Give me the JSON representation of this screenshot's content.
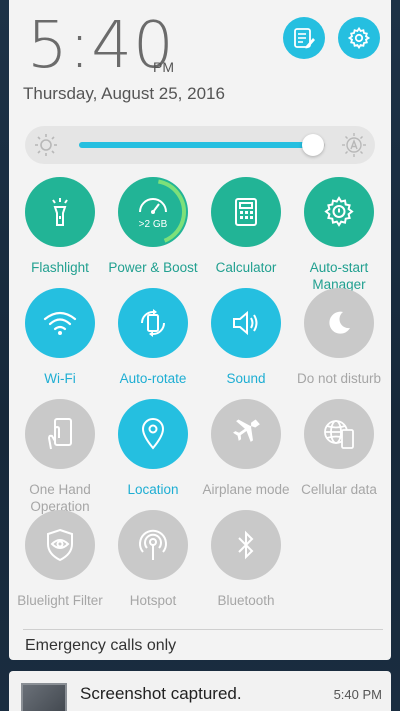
{
  "status": {
    "time": "5:40",
    "ampm": "PM",
    "date": "Thursday, August 25, 2016"
  },
  "brightness": {
    "level": 0.95
  },
  "tiles": [
    {
      "label": "Flashlight",
      "icon": "flashlight-icon",
      "state": "on-green"
    },
    {
      "label": "Power & Boost",
      "icon": "boost-gauge-icon",
      "state": "on-green",
      "badge": ">2 GB"
    },
    {
      "label": "Calculator",
      "icon": "calculator-icon",
      "state": "on-green"
    },
    {
      "label": "Auto-start Manager",
      "icon": "gear-icon",
      "state": "on-green"
    },
    {
      "label": "Wi-Fi",
      "icon": "wifi-icon",
      "state": "on-blue"
    },
    {
      "label": "Auto-rotate",
      "icon": "rotate-icon",
      "state": "on-blue"
    },
    {
      "label": "Sound",
      "icon": "speaker-icon",
      "state": "on-blue"
    },
    {
      "label": "Do not disturb",
      "icon": "moon-icon",
      "state": "off"
    },
    {
      "label": "One Hand Operation",
      "icon": "one-hand-icon",
      "state": "off"
    },
    {
      "label": "Location",
      "icon": "location-pin-icon",
      "state": "on-blue"
    },
    {
      "label": "Airplane mode",
      "icon": "airplane-icon",
      "state": "off"
    },
    {
      "label": "Cellular data",
      "icon": "globe-phone-icon",
      "state": "off"
    },
    {
      "label": "Bluelight Filter",
      "icon": "eye-shield-icon",
      "state": "off"
    },
    {
      "label": "Hotspot",
      "icon": "hotspot-icon",
      "state": "off"
    },
    {
      "label": "Bluetooth",
      "icon": "bluetooth-icon",
      "state": "off"
    }
  ],
  "footer": {
    "emergency": "Emergency calls only"
  },
  "notification": {
    "title": "Screenshot captured.",
    "time": "5:40 PM"
  },
  "colors": {
    "green": "#22b496",
    "blue": "#25bfe0",
    "grey": "#c9c9c9"
  }
}
